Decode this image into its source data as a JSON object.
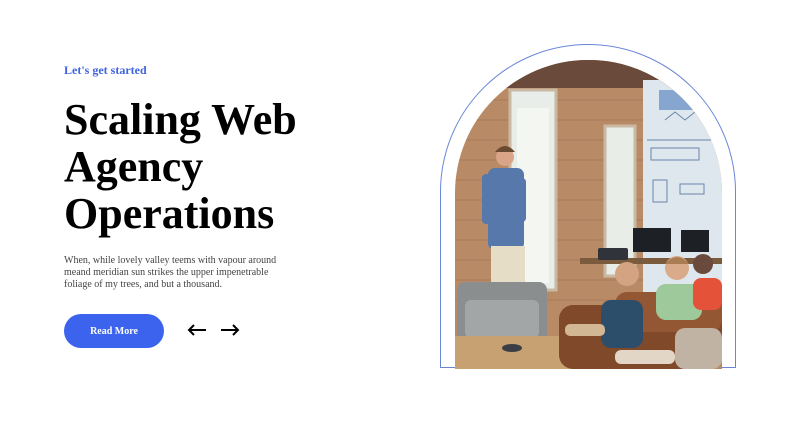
{
  "hero": {
    "eyebrow": "Let's get started",
    "headline": "Scaling Web Agency Operations",
    "description": "When, while lovely valley teems with vapour around meand meridian sun strikes the upper impenetrable foliage of my trees, and but a thousand.",
    "read_more_label": "Read More"
  },
  "nav": {
    "prev_icon": "arrow-left-icon",
    "next_icon": "arrow-right-icon"
  },
  "photo": {
    "subject": "presenter speaking to team in brick-walled office"
  },
  "colors": {
    "accent": "#3b63ee",
    "eyebrow": "#3f63e0",
    "frame_outline": "#6a86d8",
    "headline": "#000000",
    "body_text": "#444444"
  }
}
